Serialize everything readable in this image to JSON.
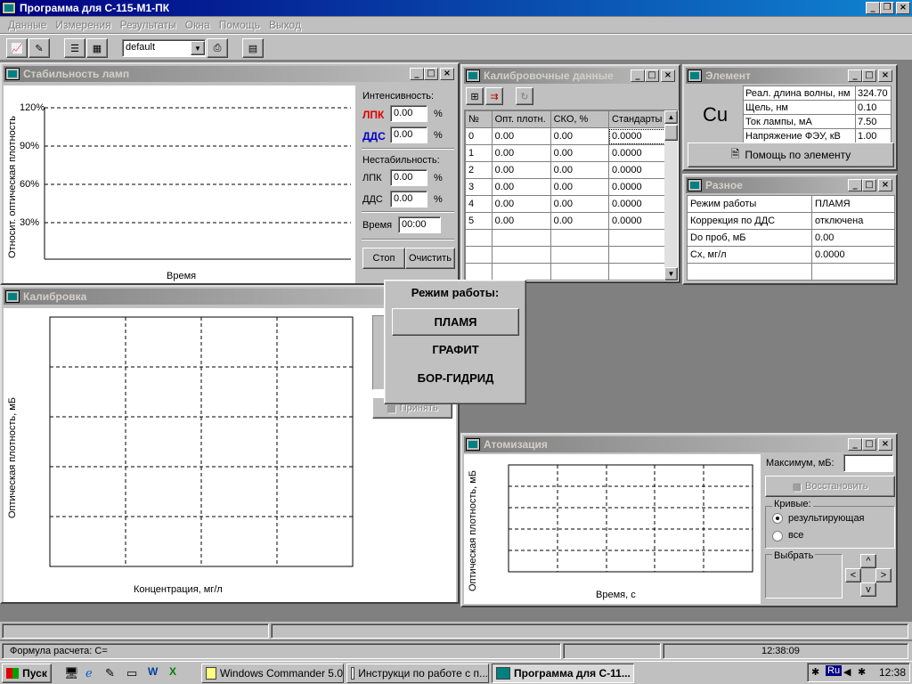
{
  "app": {
    "title": "Программа для С-115-М1-ПК"
  },
  "menu": [
    "Данные",
    "Измерения",
    "Результаты",
    "Окна",
    "Помощь",
    "Выход"
  ],
  "toolbar": {
    "profile": "default"
  },
  "lamp": {
    "title": "Стабильность ламп",
    "ylabel": "Относит. оптическая плотность",
    "xlabel": "Время",
    "ticks": [
      "120%",
      "90%",
      "60%",
      "30%"
    ],
    "intensity_label": "Интенсивность:",
    "lpk_label": "ЛПК",
    "dds_label": "ДДС",
    "lpk_value": "0.00",
    "dds_value": "0.00",
    "pct": "%",
    "instability_label": "Нестабильность:",
    "lpk2_label": "ЛПК",
    "dds2_label": "ДДС",
    "lpk2_value": "0.00",
    "dds2_value": "0.00",
    "time_label": "Время",
    "time_value": "00:00",
    "stop": "Стоп",
    "clear": "Очистить"
  },
  "calibdata": {
    "title": "Калибровочные данные",
    "headers": [
      "№",
      "Опт. плотн.",
      "СКО, %",
      "Стандарты"
    ],
    "rows": [
      [
        "0",
        "0.00",
        "0.00",
        "0.0000"
      ],
      [
        "1",
        "0.00",
        "0.00",
        "0.0000"
      ],
      [
        "2",
        "0.00",
        "0.00",
        "0.0000"
      ],
      [
        "3",
        "0.00",
        "0.00",
        "0.0000"
      ],
      [
        "4",
        "0.00",
        "0.00",
        "0.0000"
      ],
      [
        "5",
        "0.00",
        "0.00",
        "0.0000"
      ]
    ]
  },
  "element": {
    "title": "Элемент",
    "symbol": "Cu",
    "props": [
      [
        "Реал. длина волны, нм",
        "324.70"
      ],
      [
        "Щель, нм",
        "0.10"
      ],
      [
        "Ток лампы, мА",
        "7.50"
      ],
      [
        "Напряжение ФЭУ, кВ",
        "1.00"
      ]
    ],
    "help": "Помощь по элементу"
  },
  "misc": {
    "title": "Разное",
    "rows": [
      [
        "Режим работы",
        "ПЛАМЯ"
      ],
      [
        "Коррекция по ДДС",
        "отключена"
      ],
      [
        "Do проб, мБ",
        "0.00"
      ],
      [
        "Сх, мг/л",
        "0.0000"
      ]
    ]
  },
  "calib": {
    "title": "Калибровка",
    "ylabel": "Оптическая плотность, мБ",
    "xlabel": "Концентрация, мг/л",
    "accept": "Принять"
  },
  "mode": {
    "title": "Режим работы:",
    "options": [
      "ПЛАМЯ",
      "ГРАФИТ",
      "БОР-ГИДРИД"
    ]
  },
  "atom": {
    "title": "Атомизация",
    "ylabel": "Оптическая плотность, мБ",
    "xlabel": "Время, с",
    "max_label": "Максимум, мБ:",
    "restore": "Восстановить",
    "curves_label": "Кривые:",
    "curve_result": "результирующая",
    "curve_all": "все",
    "select_label": "Выбрать"
  },
  "status": {
    "formula": "Формула расчета: С=",
    "time": "12:38:09"
  },
  "taskbar": {
    "start": "Пуск",
    "tasks": [
      "Windows Commander 5.0",
      "Инструкци по работе с п...",
      "Программа для С-11..."
    ],
    "lang": "Ru",
    "clock": "12:38"
  }
}
